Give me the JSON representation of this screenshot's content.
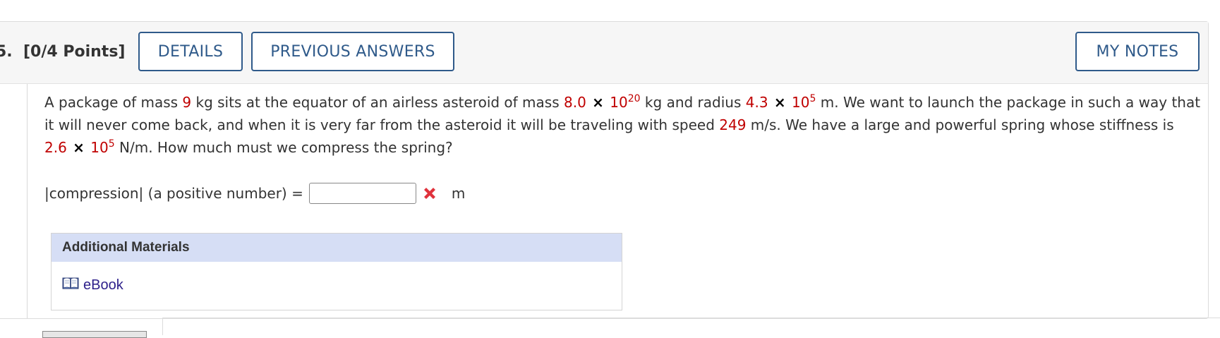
{
  "header": {
    "question_number": "5.",
    "points": "[0/4 Points]",
    "details_label": "DETAILS",
    "previous_answers_label": "PREVIOUS ANSWERS",
    "my_notes_label": "MY NOTES"
  },
  "problem": {
    "t1": "A package of mass ",
    "mass": "9",
    "t2": " kg sits at the equator of an airless asteroid of mass ",
    "ast_mass_coef": "8.0",
    "times": "×",
    "ast_mass_base": "10",
    "ast_mass_exp": "20",
    "t3": " kg and radius ",
    "radius_coef": "4.3",
    "radius_base": "10",
    "radius_exp": "5",
    "t4": " m. We want to launch the package in such a way that it will never come back, and when it is very far from the asteroid it will be traveling with speed ",
    "speed": "249",
    "t5": " m/s. We have a large and powerful spring whose stiffness is ",
    "k_coef": "2.6",
    "k_base": "10",
    "k_exp": "5",
    "t6": " N/m. How much must we compress the spring?"
  },
  "answer": {
    "label": "|compression| (a positive number) =",
    "value": "",
    "status_icon": "red-x-incorrect-icon",
    "unit": "m"
  },
  "materials": {
    "header": "Additional Materials",
    "ebook_label": "eBook",
    "ebook_icon": "book-icon"
  },
  "colors": {
    "accent": "#2f5a8a",
    "given_value": "#c00000",
    "materials_header_bg": "#d6def5",
    "link": "#2d1f8a",
    "incorrect": "#e0323c"
  }
}
